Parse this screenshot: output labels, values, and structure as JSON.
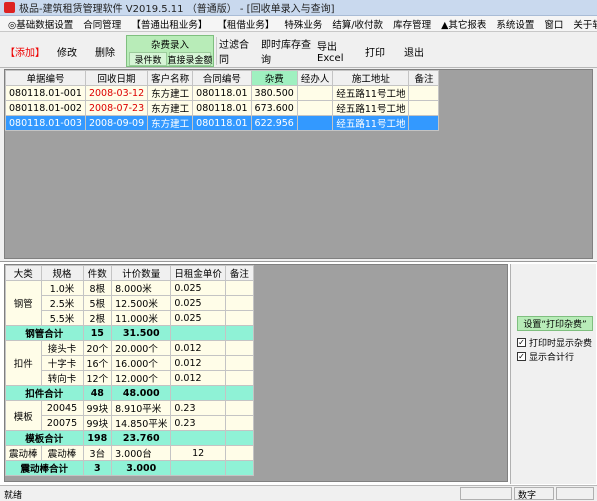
{
  "title": "极品-建筑租赁管理软件 V2019.5.11 （普通版） - [回收单录入与查询]",
  "menu": [
    "◎基础数据设置",
    "合同管理",
    "【普通出租业务】",
    "【租借业务】",
    "特殊业务",
    "结算/收付款",
    "库存管理",
    "▲其它报表",
    "系统设置",
    "窗口",
    "关于软件"
  ],
  "toolbar": {
    "add": "【添加】",
    "edit": "修改",
    "delete": "删除",
    "misc_group": "杂费录入",
    "by_count": "录件数",
    "direct_amount": "直接录金额",
    "filter_contract": "过滤合同",
    "realtime_stock": "即时库存查询",
    "export": "导出Excel",
    "print": "打印",
    "exit": "退出"
  },
  "top_table": {
    "headers": [
      "单据编号",
      "回收日期",
      "客户名称",
      "合同编号",
      "杂费",
      "经办人",
      "施工地址",
      "备注"
    ],
    "rows": [
      [
        "080118.01-001",
        "2008-03-12",
        "东方建工",
        "080118.01",
        "380.500",
        "",
        "经五路11号工地",
        ""
      ],
      [
        "080118.01-002",
        "2008-07-23",
        "东方建工",
        "080118.01",
        "673.600",
        "",
        "经五路11号工地",
        ""
      ],
      [
        "080118.01-003",
        "2008-09-09",
        "东方建工",
        "080118.01",
        "622.956",
        "",
        "经五路11号工地",
        ""
      ]
    ]
  },
  "bottom_table": {
    "headers": [
      "大类",
      "规格",
      "件数",
      "计价数量",
      "日租金单价",
      "备注"
    ],
    "groups": [
      {
        "category": "钢管",
        "rows": [
          [
            "1.0米",
            "8根",
            "8.000米",
            "0.025",
            ""
          ],
          [
            "2.5米",
            "5根",
            "12.500米",
            "0.025",
            ""
          ],
          [
            "5.5米",
            "2根",
            "11.000米",
            "0.025",
            ""
          ]
        ],
        "subtotal": [
          "钢管合计",
          "15",
          "31.500"
        ]
      },
      {
        "category": "扣件",
        "rows": [
          [
            "接头卡",
            "20个",
            "20.000个",
            "0.012",
            ""
          ],
          [
            "十字卡",
            "16个",
            "16.000个",
            "0.012",
            ""
          ],
          [
            "转向卡",
            "12个",
            "12.000个",
            "0.012",
            ""
          ]
        ],
        "subtotal": [
          "扣件合计",
          "48",
          "48.000"
        ]
      },
      {
        "category": "模板",
        "rows": [
          [
            "20045",
            "99块",
            "8.910平米",
            "0.23",
            ""
          ],
          [
            "20075",
            "99块",
            "14.850平米",
            "0.23",
            ""
          ]
        ],
        "subtotal": [
          "模板合计",
          "198",
          "23.760"
        ]
      },
      {
        "category": "震动棒",
        "rows": [
          [
            "震动棒",
            "3台",
            "3.000台",
            "12",
            ""
          ]
        ],
        "subtotal": [
          "震动棒合计",
          "3",
          "3.000"
        ]
      }
    ]
  },
  "right_panel": {
    "set_print": "设置“打印杂费”",
    "opt1": "打印时显示杂费",
    "opt2": "显示合计行",
    "opt1_checked": true,
    "opt2_checked": true
  },
  "status": {
    "left": "就绪",
    "mode": "数字"
  }
}
